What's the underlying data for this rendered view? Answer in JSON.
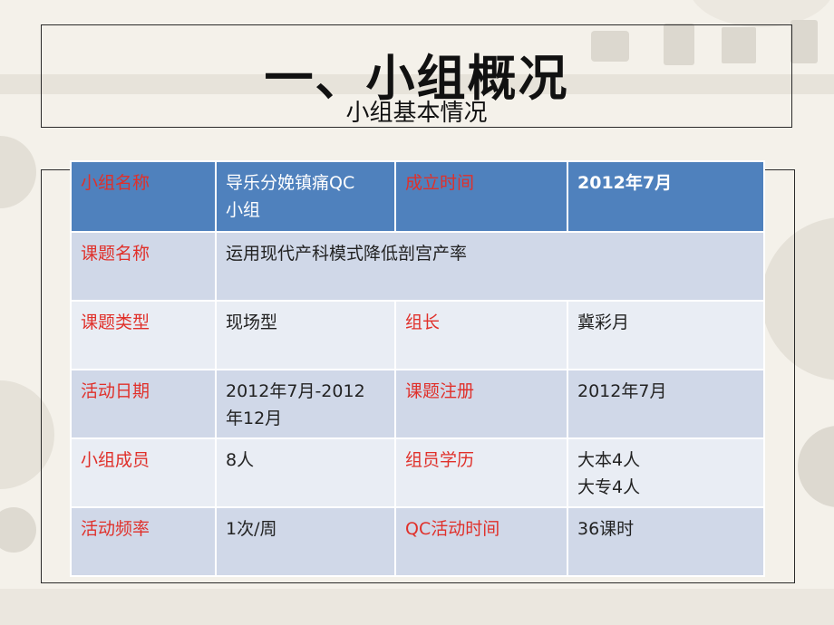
{
  "title": {
    "main": "一、小组概况",
    "sub": "小组基本情况"
  },
  "colors": {
    "header_row": "#4f81bd",
    "row_dark": "#d0d8e8",
    "row_light": "#e9edf4",
    "label_text": "#e0302a"
  },
  "table": {
    "rows": [
      {
        "label1": "小组名称",
        "value1": [
          "导乐分娩镇痛QC",
          "小组"
        ],
        "label2": "成立时间",
        "value2": [
          "2012年7月"
        ]
      },
      {
        "label1": "课题名称",
        "value1": [
          "运用现代产科模式降低剖宫产率"
        ]
      },
      {
        "label1": "课题类型",
        "value1": [
          "现场型"
        ],
        "label2": "组长",
        "value2": [
          "冀彩月"
        ]
      },
      {
        "label1": "活动日期",
        "value1": [
          "2012年7月-2012",
          "年12月"
        ],
        "label2": "课题注册",
        "value2": [
          "2012年7月"
        ]
      },
      {
        "label1": "小组成员",
        "value1": [
          "8人"
        ],
        "label2": "组员学历",
        "value2": [
          "大本4人",
          "大专4人"
        ]
      },
      {
        "label1": "活动频率",
        "value1": [
          "1次/周"
        ],
        "label2": "QC活动时间",
        "value2": [
          "36课时"
        ]
      }
    ]
  }
}
